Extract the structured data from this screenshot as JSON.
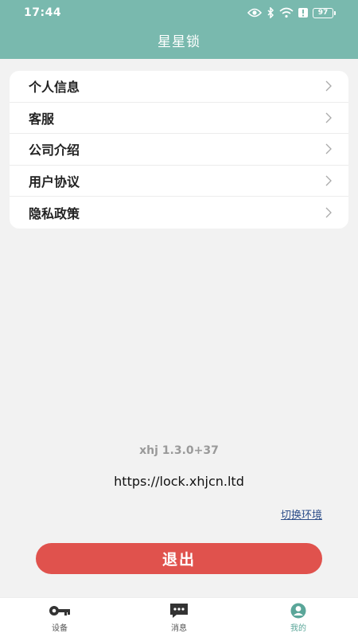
{
  "status": {
    "time": "17:44",
    "battery": "97"
  },
  "header": {
    "title": "星星锁"
  },
  "menu": {
    "items": [
      {
        "label": "个人信息"
      },
      {
        "label": "客服"
      },
      {
        "label": "公司介绍"
      },
      {
        "label": "用户协议"
      },
      {
        "label": "隐私政策"
      }
    ]
  },
  "info": {
    "version": "xhj 1.3.0+37",
    "url": "https://lock.xhjcn.ltd",
    "switch_env": "切换环境"
  },
  "actions": {
    "logout": "退出"
  },
  "tabbar": {
    "tabs": [
      {
        "label": "设备",
        "icon": "key-icon"
      },
      {
        "label": "消息",
        "icon": "message-icon"
      },
      {
        "label": "我的",
        "icon": "user-icon"
      }
    ],
    "active_index": 2
  },
  "colors": {
    "header": "#79b9ae",
    "logout": "#e0524d",
    "active_tab": "#5aa699"
  }
}
